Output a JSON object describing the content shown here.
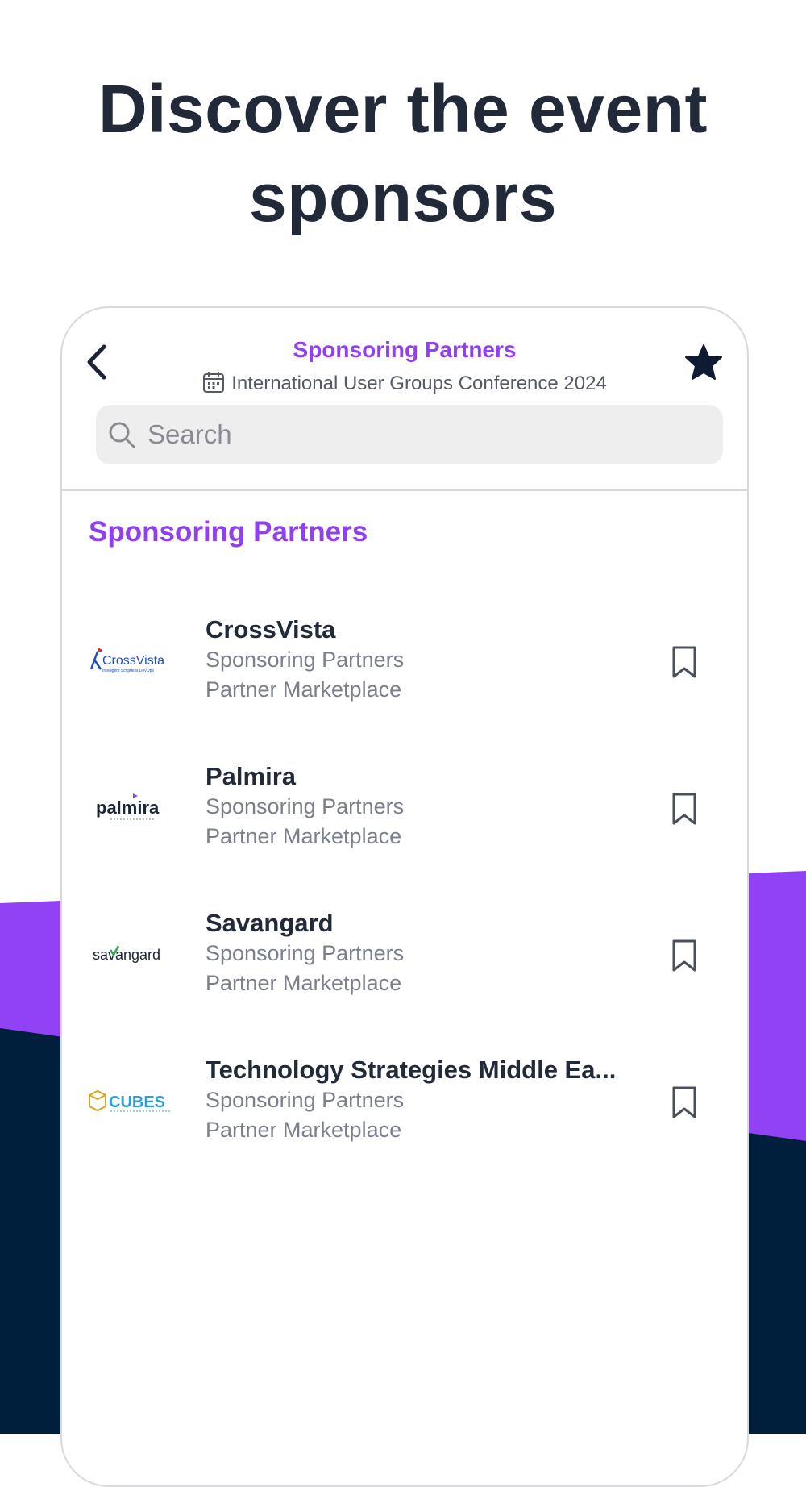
{
  "headline": {
    "line1": "Discover the event",
    "line2": "sponsors"
  },
  "colors": {
    "accent": "#9040f0",
    "navy": "#001f3d",
    "purple": "#9142f5"
  },
  "app": {
    "title": "Sponsoring Partners",
    "event": "International User Groups Conference 2024",
    "search_placeholder": "Search",
    "icons": {
      "back": "chevron-left-icon",
      "favorite": "star-icon",
      "calendar": "calendar-icon",
      "search": "search-icon",
      "bookmark": "bookmark-icon"
    }
  },
  "section": {
    "title": "Sponsoring Partners"
  },
  "sponsors": [
    {
      "name": "CrossVista",
      "category": "Sponsoring Partners",
      "tag": "Partner Marketplace",
      "logo_text": "CrossVista",
      "logo_tagline": "Intelligent Scriptless DevOps"
    },
    {
      "name": "Palmira",
      "category": "Sponsoring Partners",
      "tag": "Partner Marketplace",
      "logo_text": "palmira",
      "logo_tagline": ""
    },
    {
      "name": "Savangard",
      "category": "Sponsoring Partners",
      "tag": "Partner Marketplace",
      "logo_text": "savangard",
      "logo_tagline": ""
    },
    {
      "name": "Technology Strategies Middle Ea...",
      "category": "Sponsoring Partners",
      "tag": "Partner Marketplace",
      "logo_text": "CUBES",
      "logo_tagline": ""
    }
  ]
}
